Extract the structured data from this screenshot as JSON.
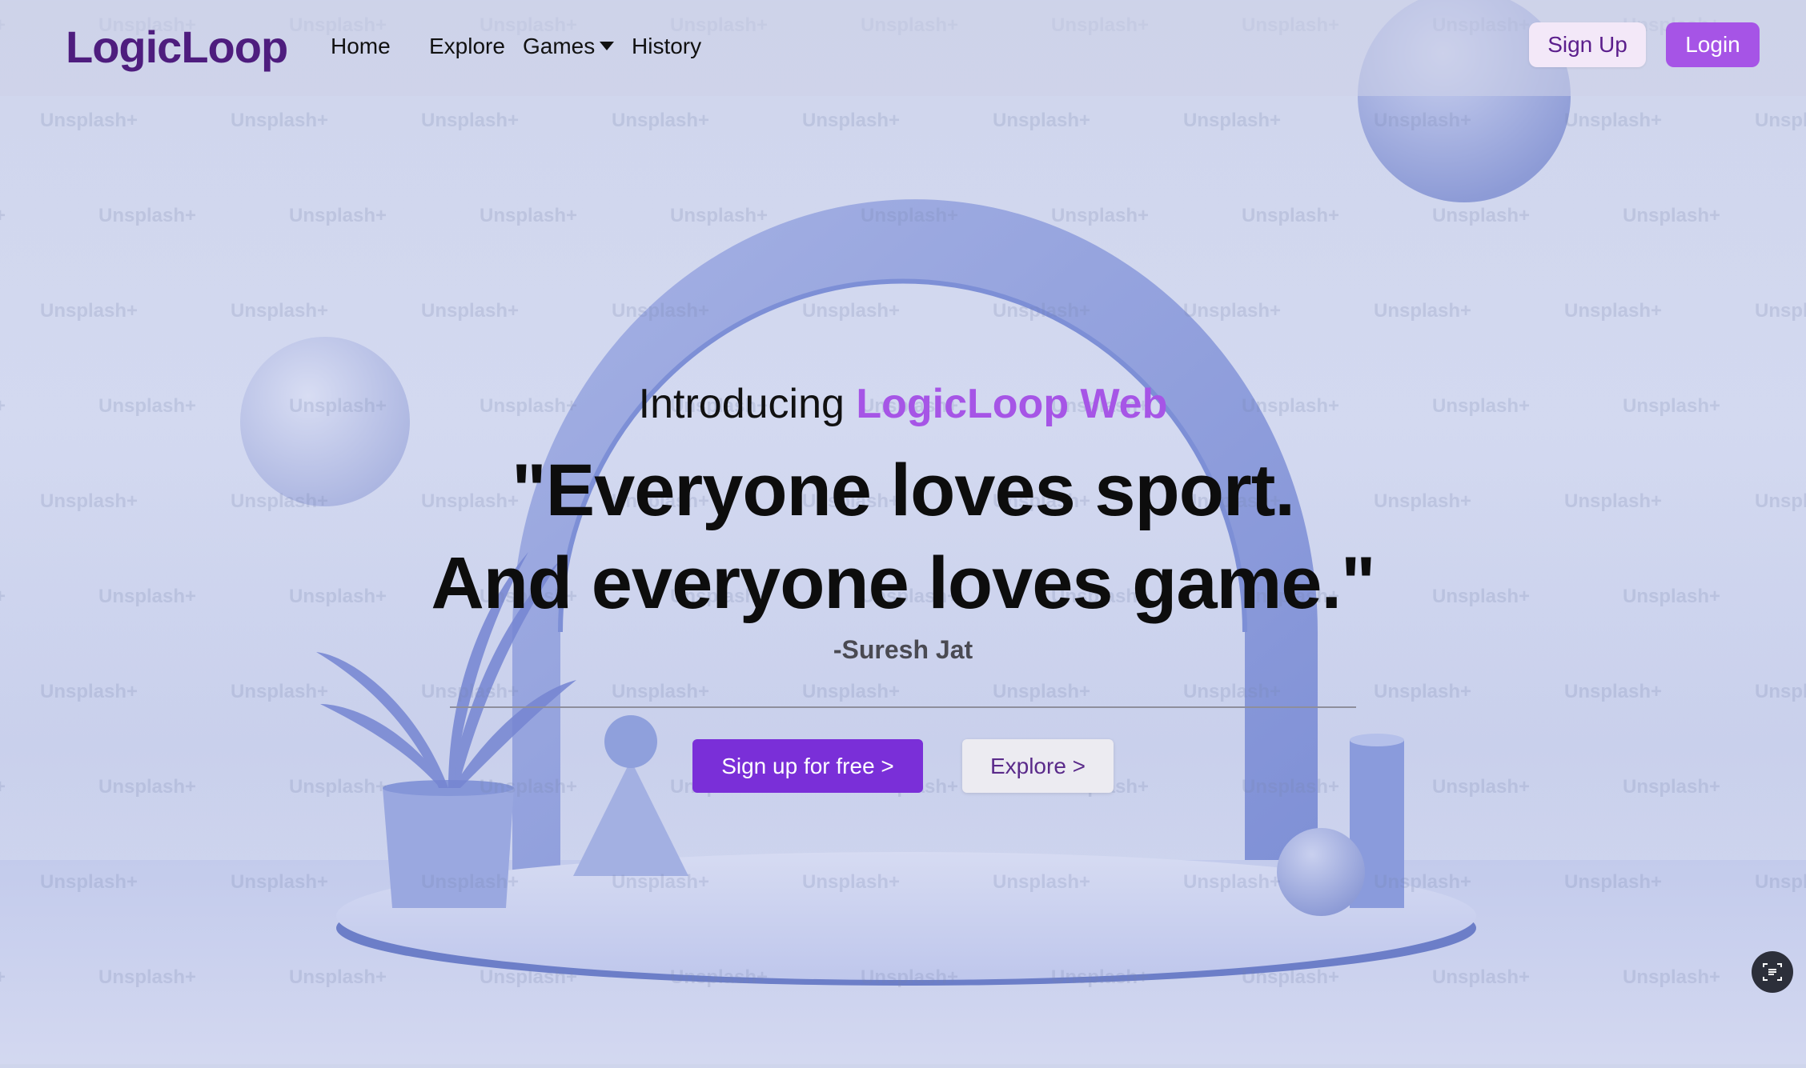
{
  "nav": {
    "logo": "LogicLoop",
    "links": [
      "Home",
      "Explore",
      "Games",
      "History"
    ],
    "signup_label": "Sign Up",
    "login_label": "Login"
  },
  "hero": {
    "intro_prefix": "Introducing ",
    "intro_brand": "LogicLoop Web",
    "quote_line1": "\"Everyone loves sport.",
    "quote_line2": "And everyone loves game.\"",
    "author": "-Suresh Jat",
    "cta_primary": "Sign up for free >",
    "cta_secondary": "Explore >"
  },
  "background": {
    "watermark_text": "Unsplash+"
  },
  "colors": {
    "brand_dark": "#4e1d7e",
    "brand_accent": "#a655e6",
    "cta_primary": "#7a2fd8",
    "arch": "#8e9ed8"
  },
  "icons": {
    "games_dropdown": "caret-down-icon",
    "scan": "text-scan-icon"
  }
}
